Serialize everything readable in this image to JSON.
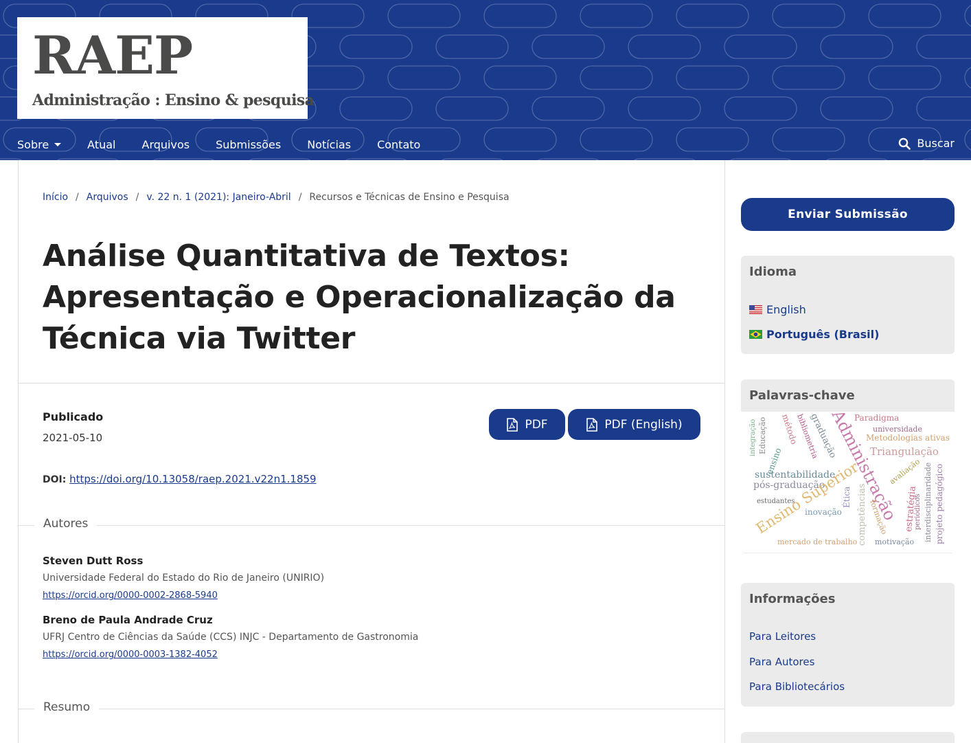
{
  "logo": {
    "title": "RAEP",
    "subtitle": "Administração : Ensino & pesquisa"
  },
  "nav": {
    "items": [
      {
        "label": "Sobre",
        "has_dropdown": true
      },
      {
        "label": "Atual"
      },
      {
        "label": "Arquivos"
      },
      {
        "label": "Submissões"
      },
      {
        "label": "Notícias"
      },
      {
        "label": "Contato"
      }
    ],
    "search_label": "Buscar"
  },
  "breadcrumb": {
    "items": [
      "Início",
      "Arquivos",
      "v. 22 n. 1 (2021): Janeiro-Abril"
    ],
    "current": "Recursos e Técnicas de Ensino e Pesquisa",
    "separator": "/"
  },
  "article": {
    "title": "Análise Quantitativa de Textos: Apresentação e Operacionalização da Técnica via Twitter",
    "published_label": "Publicado",
    "published_date": "2021-05-10",
    "doi_label": "DOI:",
    "doi_url": "https://doi.org/10.13058/raep.2021.v22n1.1859",
    "galleys": [
      {
        "label": "PDF",
        "icon": "file-pdf-icon"
      },
      {
        "label": "PDF (English)",
        "icon": "file-pdf-icon"
      }
    ],
    "authors_heading": "Autores",
    "authors": [
      {
        "name": "Steven Dutt Ross",
        "affiliation": "Universidade Federal do Estado do Rio de Janeiro (UNIRIO)",
        "orcid": "https://orcid.org/0000-0002-2868-5940"
      },
      {
        "name": "Breno de Paula Andrade Cruz",
        "affiliation": "UFRJ Centro de Ciências da Saúde (CCS) INJC - Departamento de Gastronomia",
        "orcid": "https://orcid.org/0000-0003-1382-4052"
      }
    ],
    "abstract_heading": "Resumo"
  },
  "sidebar": {
    "submit_label": "Enviar Submissão",
    "language": {
      "title": "Idioma",
      "items": [
        {
          "label": "English",
          "flag": "us-flag-icon",
          "active": false
        },
        {
          "label": "Português (Brasil)",
          "flag": "brazil-flag-icon",
          "active": true
        }
      ]
    },
    "keywords": {
      "title": "Palavras-chave",
      "words": [
        "integração",
        "Educação",
        "ensino",
        "método",
        "bibliometria",
        "graduação",
        "Administração",
        "Paradigma",
        "universidade",
        "Metodologias ativas",
        "Triangulação",
        "avaliação",
        "sustentabilidade",
        "pós-graduação",
        "Ensino Superior",
        "Ética",
        "estudantes",
        "inovação",
        "competências",
        "formação",
        "estratégia",
        "periódicos",
        "interdisciplinaridade",
        "projeto pedagógico",
        "mercado de trabalho",
        "motivação"
      ]
    },
    "info": {
      "title": "Informações",
      "links": [
        "Para Leitores",
        "Para Autores",
        "Para Bibliotecários"
      ]
    }
  },
  "colors": {
    "primary": "#1a3a8c",
    "block_bg": "#ebebeb"
  }
}
